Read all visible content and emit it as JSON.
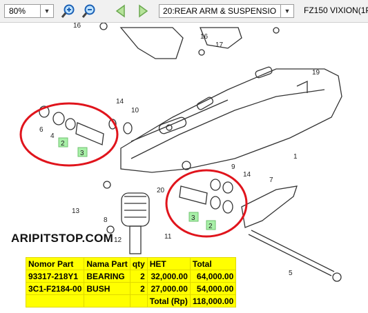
{
  "toolbar": {
    "zoom_value": "80%",
    "zoom_in_icon": "magnifier-plus-icon",
    "zoom_out_icon": "magnifier-minus-icon",
    "back_icon": "arrow-left-icon",
    "forward_icon": "arrow-right-icon",
    "sheet_select": "20:REAR ARM & SUSPENSIO",
    "model_title": "FZ150 VIXION(1P"
  },
  "diagram": {
    "callouts": [
      "16",
      "16",
      "17",
      "19",
      "14",
      "10",
      "6",
      "4",
      "2",
      "3",
      "1",
      "9",
      "14",
      "7",
      "20",
      "13",
      "8",
      "3",
      "2",
      "11",
      "12",
      "5"
    ]
  },
  "watermark": "ARIPITSTOP.COM",
  "parts_table": {
    "headers": [
      "Nomor Part",
      "Nama Part",
      "qty",
      "HET",
      "Total"
    ],
    "rows": [
      {
        "part_no": "93317-218Y1",
        "name": "BEARING",
        "qty": "2",
        "het": "32,000.00",
        "total": "64,000.00"
      },
      {
        "part_no": "3C1-F2184-00",
        "name": "BUSH",
        "qty": "2",
        "het": "27,000.00",
        "total": "54,000.00"
      }
    ],
    "total_label": "Total (Rp)",
    "total_value": "118,000.00"
  },
  "colors": {
    "highlight_circle": "#e0141c",
    "table_bg": "#ffff00",
    "callout_box": "#a8f0a8"
  }
}
